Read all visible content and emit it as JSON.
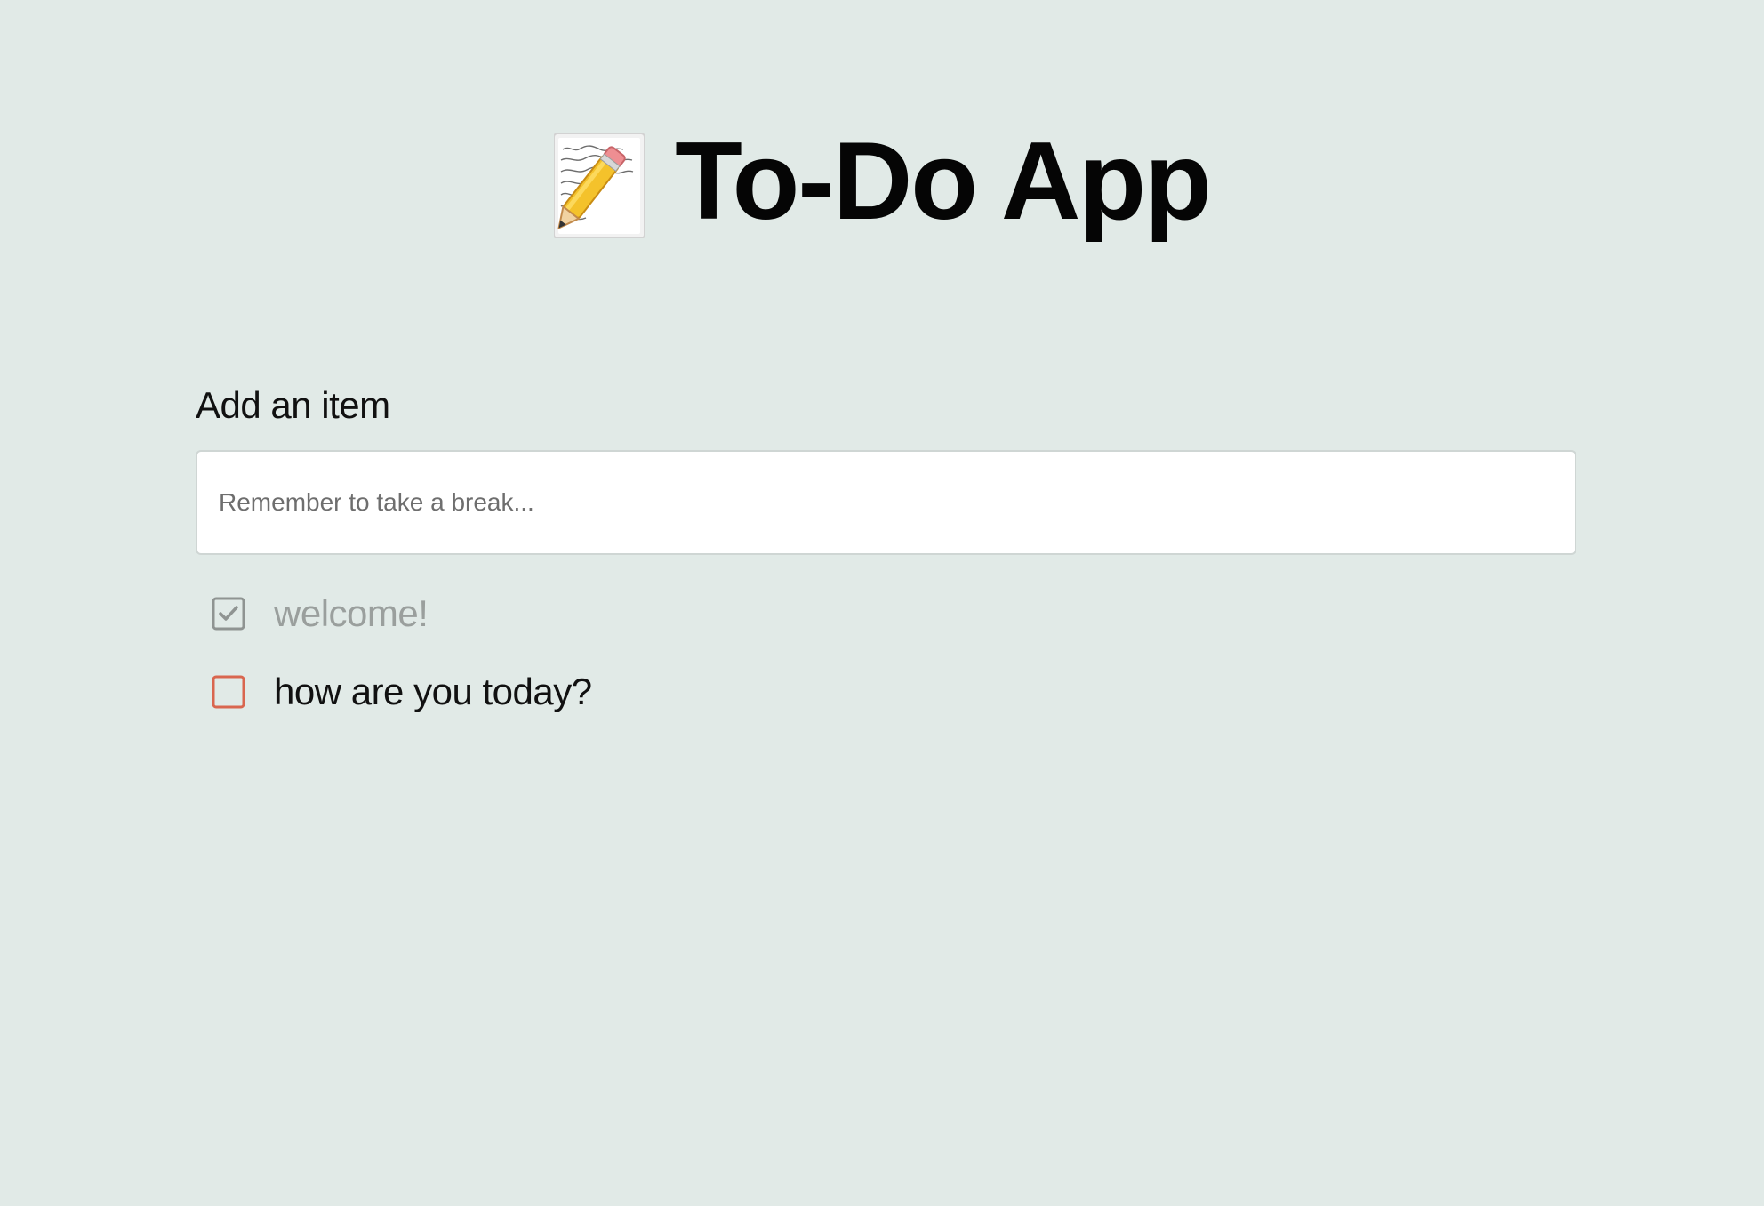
{
  "header": {
    "icon": "memo-pencil-icon",
    "title": "To-Do App"
  },
  "form": {
    "label": "Add an item",
    "input": {
      "placeholder": "Remember to take a break...",
      "value": ""
    }
  },
  "todos": [
    {
      "text": "welcome!",
      "checked": true
    },
    {
      "text": "how are you today?",
      "checked": false
    }
  ],
  "colors": {
    "background": "#e1eae7",
    "checked_box": "#8f9492",
    "unchecked_box": "#d9664f",
    "checked_text": "#9a9f9d"
  }
}
